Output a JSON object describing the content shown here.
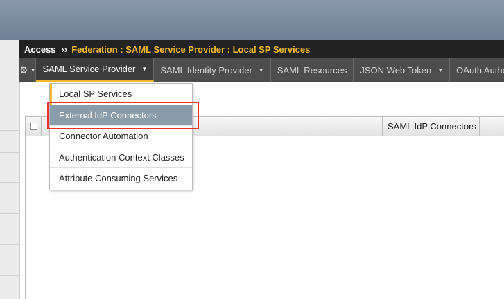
{
  "breadcrumb": {
    "root": "Access",
    "separator": "››",
    "path": "Federation : SAML Service Provider : Local SP Services"
  },
  "nav": {
    "settings_icon": "gear-icon",
    "tabs": [
      {
        "label": "SAML Service Provider",
        "has_caret": true,
        "active": true
      },
      {
        "label": "SAML Identity Provider",
        "has_caret": true,
        "active": false
      },
      {
        "label": "SAML Resources",
        "has_caret": false,
        "active": false
      },
      {
        "label": "JSON Web Token",
        "has_caret": true,
        "active": false
      },
      {
        "label": "OAuth Authorization",
        "has_caret": false,
        "active": false
      }
    ]
  },
  "dropdown": {
    "items": [
      {
        "label": "Local SP Services",
        "state": "current"
      },
      {
        "label": "External IdP Connectors",
        "state": "hover"
      },
      {
        "label": "Connector Automation",
        "state": "normal"
      },
      {
        "label": "Authentication Context Classes",
        "state": "normal"
      },
      {
        "label": "Attribute Consuming Services",
        "state": "normal"
      }
    ]
  },
  "table": {
    "columns": [
      "SAML IdP Connectors"
    ]
  },
  "colors": {
    "accent": "#f5b82e",
    "nav_bg": "#4d4d4d",
    "breadcrumb_bg": "#222222",
    "hover_bg": "#8b9cab",
    "highlight": "#e8322b"
  }
}
